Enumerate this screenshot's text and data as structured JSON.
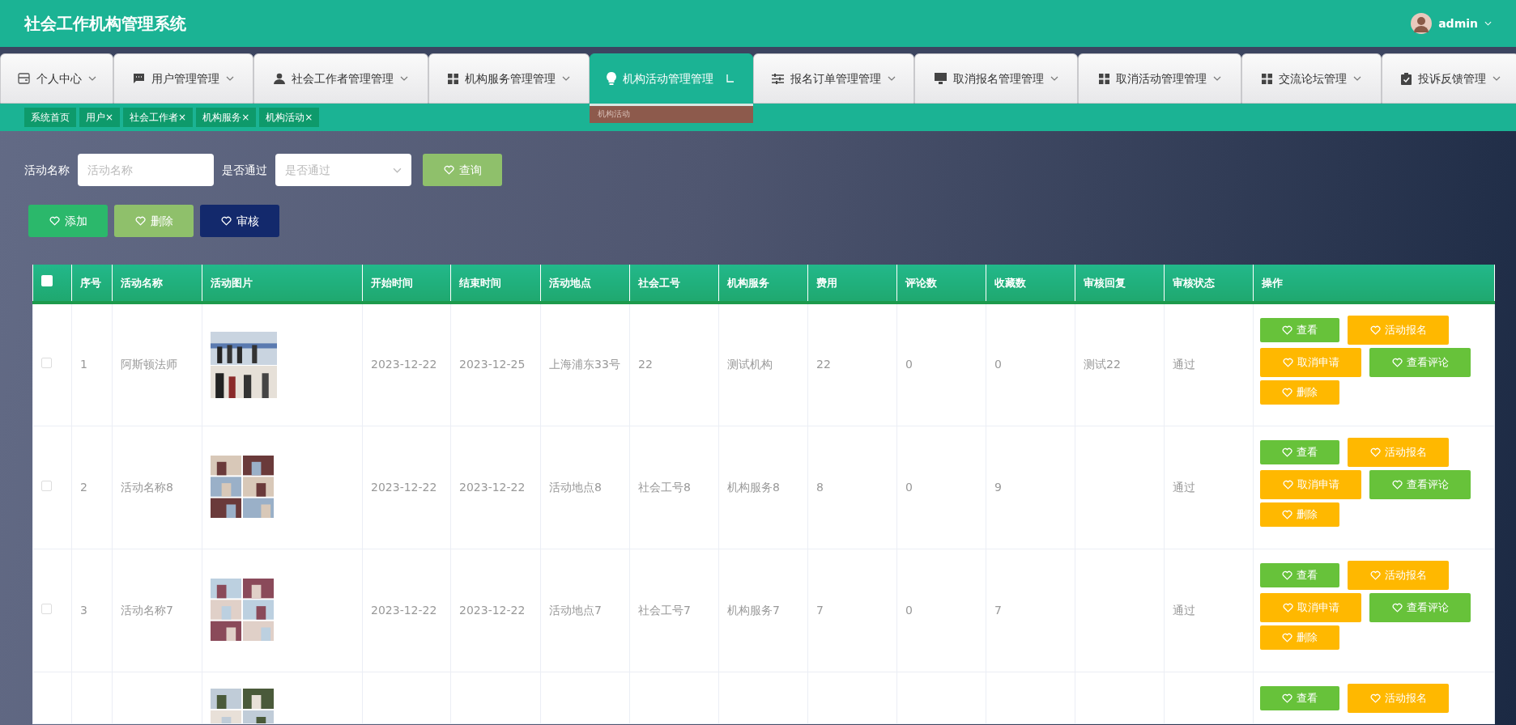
{
  "header": {
    "title": "社会工作机构管理系统",
    "user": "admin"
  },
  "nav_tabs": [
    {
      "label": "个人中心",
      "selected": false
    },
    {
      "label": "用户管理管理",
      "selected": false
    },
    {
      "label": "社会工作者管理管理",
      "selected": false
    },
    {
      "label": "机构服务管理管理",
      "selected": false
    },
    {
      "label": "机构活动管理管理",
      "selected": true
    },
    {
      "label": "报名订单管理管理",
      "selected": false
    },
    {
      "label": "取消报名管理管理",
      "selected": false
    },
    {
      "label": "取消活动管理管理",
      "selected": false
    },
    {
      "label": "交流论坛管理",
      "selected": false
    },
    {
      "label": "投诉反馈管理",
      "selected": false
    }
  ],
  "nav_submenu": {
    "items": [
      "机构活动"
    ]
  },
  "tags": [
    {
      "label": "系统首页"
    },
    {
      "label": "用户",
      "close": "×"
    },
    {
      "label": "社会工作者",
      "close": "×"
    },
    {
      "label": "机构服务",
      "close": "×"
    },
    {
      "label": "机构活动",
      "close": "×"
    }
  ],
  "filters": [
    {
      "kind": "text",
      "label": "活动名称",
      "placeholder": "活动名称"
    },
    {
      "kind": "select",
      "label": "是否通过",
      "placeholder": "是否通过"
    }
  ],
  "search_button": {
    "label": "查询",
    "color": "#8fc06b"
  },
  "action_buttons": [
    {
      "label": "添加",
      "color": "#2bb86b"
    },
    {
      "label": "删除",
      "color": "#8fc06b"
    },
    {
      "label": "审核",
      "color": "#13296c"
    }
  ],
  "table": {
    "columns": [
      {
        "kind": "check",
        "selected": false
      },
      {
        "kind": "text",
        "label": "序号"
      },
      {
        "kind": "text",
        "label": "活动名称"
      },
      {
        "kind": "picture",
        "label": "活动图片"
      },
      {
        "kind": "text",
        "label": "开始时间"
      },
      {
        "kind": "text",
        "label": "结束时间"
      },
      {
        "kind": "text",
        "label": "活动地点"
      },
      {
        "kind": "text",
        "label": "社会工号"
      },
      {
        "kind": "text",
        "label": "机构服务"
      },
      {
        "kind": "text",
        "label": "费用"
      },
      {
        "kind": "text",
        "label": "评论数"
      },
      {
        "kind": "text",
        "label": "收藏数"
      },
      {
        "kind": "text",
        "label": "审核回复"
      },
      {
        "kind": "text",
        "label": "审核状态"
      },
      {
        "kind": "actions",
        "label": "操作"
      }
    ],
    "rows": [
      {
        "selected": false,
        "no": "1",
        "name": "阿斯顿法师",
        "start": "2023-12-22",
        "end": "2023-12-25",
        "place": "上海浦东33号",
        "worker": "22",
        "service": "测试机构",
        "fee": "22",
        "comments": "0",
        "favorites": "0",
        "reply": "测试22",
        "status": "通过",
        "actions": [
          {
            "label": "查看",
            "color": "#67c23a"
          },
          {
            "label": "活动报名",
            "color": "#ffb800"
          },
          {
            "label": "取消申请",
            "color": "#ffb800"
          },
          {
            "label": "查看评论",
            "color": "#67c23a"
          },
          {
            "label": "删除",
            "color": "#ffb800"
          }
        ]
      },
      {
        "selected": false,
        "no": "2",
        "name": "活动名称8",
        "start": "2023-12-22",
        "end": "2023-12-22",
        "place": "活动地点8",
        "worker": "社会工号8",
        "service": "机构服务8",
        "fee": "8",
        "comments": "0",
        "favorites": "9",
        "status": "通过",
        "actions": [
          {
            "label": "查看",
            "color": "#67c23a"
          },
          {
            "label": "活动报名",
            "color": "#ffb800"
          },
          {
            "label": "取消申请",
            "color": "#ffb800"
          },
          {
            "label": "查看评论",
            "color": "#67c23a"
          },
          {
            "label": "删除",
            "color": "#ffb800"
          }
        ]
      },
      {
        "selected": false,
        "no": "3",
        "name": "活动名称7",
        "start": "2023-12-22",
        "end": "2023-12-22",
        "place": "活动地点7",
        "worker": "社会工号7",
        "service": "机构服务7",
        "fee": "7",
        "comments": "0",
        "favorites": "7",
        "status": "通过",
        "actions": [
          {
            "label": "查看",
            "color": "#67c23a"
          },
          {
            "label": "活动报名",
            "color": "#ffb800"
          },
          {
            "label": "取消申请",
            "color": "#ffb800"
          },
          {
            "label": "查看评论",
            "color": "#67c23a"
          },
          {
            "label": "删除",
            "color": "#ffb800"
          }
        ]
      },
      {
        "actions": [
          {
            "label": "查看",
            "color": "#67c23a"
          },
          {
            "label": "活动报名",
            "color": "#ffb800"
          }
        ]
      }
    ]
  }
}
